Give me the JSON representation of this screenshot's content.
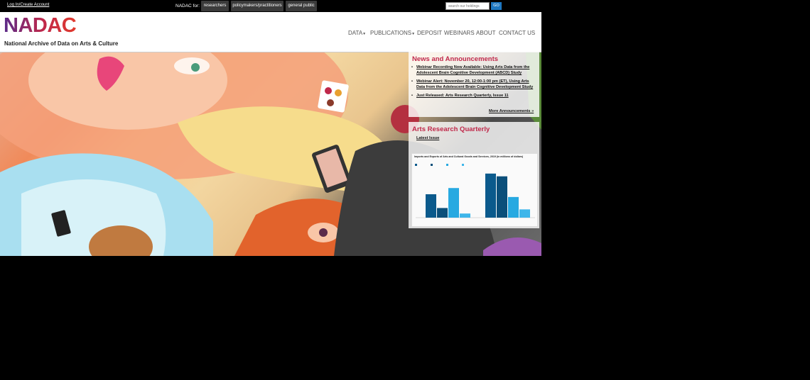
{
  "topbar": {
    "login_label": "Log In/Create Account",
    "nadac_for_label": "NADAC for:",
    "audiences": [
      "researchers",
      "policymakers/practitioners",
      "general public"
    ],
    "search_placeholder": "search our holdings",
    "search_button": "GO"
  },
  "header": {
    "logo_text": "NADAC",
    "logo_subtitle": "National Archive of Data on Arts & Culture",
    "nav": [
      {
        "label": "DATA",
        "dropdown": true
      },
      {
        "label": "PUBLICATIONS",
        "dropdown": true
      },
      {
        "label": "DEPOSIT",
        "dropdown": false
      },
      {
        "label": "WEBINARS",
        "dropdown": false
      },
      {
        "label": "ABOUT",
        "dropdown": false
      },
      {
        "label": "CONTACT US",
        "dropdown": false
      }
    ]
  },
  "news": {
    "title": "News and Announcements",
    "items": [
      "Webinar Recording Now Available: Using Arts Data from the Adolescent Brain Cognitive Development (ABCD) Study",
      "Webinar Alert: November 20, 12:00-1:00 pm (ET), Using Arts Data from the Adolescent Brain Cognitive Development Study",
      "Just Released: Arts Research Quarterly, Issue 11"
    ],
    "more_label": "More Announcements »"
  },
  "arq": {
    "title": "Arts Research Quarterly",
    "latest_label": "Latest Issue",
    "chart_title": "Imports and Exports of Arts and Cultural Goods and Services, 2019 (in millions of dollars)"
  },
  "colors": {
    "accent": "#c0284a",
    "topbar_bg": "#000000",
    "audience_bg": "#3b3b3b",
    "go_button": "#1e78c2",
    "bar_dark": "#0b5a8c",
    "bar_light": "#27a9e1"
  },
  "chart_data": {
    "type": "bar",
    "title": "Imports and Exports of Arts and Cultural Goods and Services, 2019 (in millions of dollars)",
    "groups": 2,
    "series": [
      {
        "color": "#0b5a8c",
        "values": [
          34,
          64
        ]
      },
      {
        "color": "#0b4f7a",
        "values": [
          14,
          60
        ]
      },
      {
        "color": "#27a9e1",
        "values": [
          43,
          30
        ]
      },
      {
        "color": "#3fb6ea",
        "values": [
          6,
          12
        ]
      }
    ],
    "ylim": [
      0,
      70
    ]
  }
}
